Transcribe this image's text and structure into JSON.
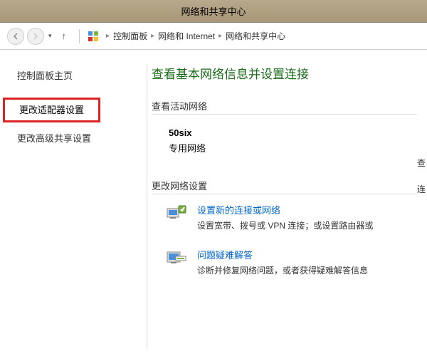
{
  "window": {
    "title": "网络和共享中心"
  },
  "nav": {
    "breadcrumb": [
      "控制面板",
      "网络和 Internet",
      "网络和共享中心"
    ]
  },
  "sidebar": {
    "home": "控制面板主页",
    "adapter": "更改适配器设置",
    "advanced": "更改高级共享设置"
  },
  "main": {
    "heading": "查看基本网络信息并设置连接",
    "active_header": "查看活动网络",
    "active_network": {
      "name": "50six",
      "type": "专用网络"
    },
    "change_header": "更改网络设置",
    "setup": {
      "link": "设置新的连接或网络",
      "desc": "设置宽带、拨号或 VPN 连接；或设置路由器或"
    },
    "troubleshoot": {
      "link": "问题疑难解答",
      "desc": "诊断并修复网络问题，或者获得疑难解答信息"
    }
  },
  "right": {
    "c1": "查",
    "c2": "连"
  }
}
